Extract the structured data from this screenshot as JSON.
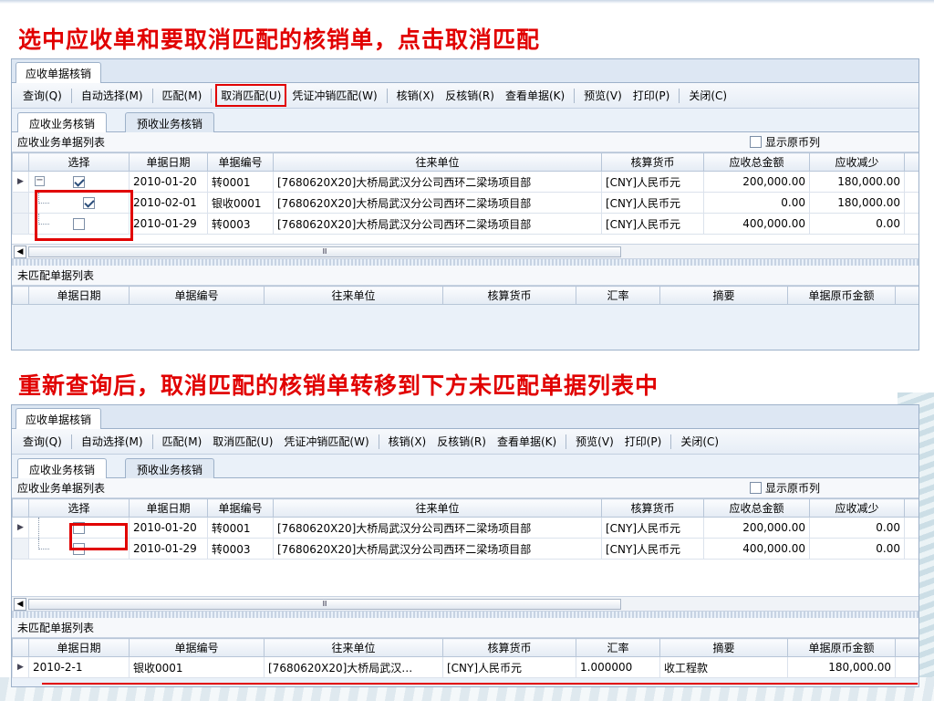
{
  "captions": {
    "top": "选中应收单和要取消匹配的核销单，点击取消匹配",
    "middle": "重新查询后，取消匹配的核销单转移到下方未匹配单据列表中"
  },
  "window": {
    "tab": "应收单据核销"
  },
  "toolbar": {
    "query": "查询(Q)",
    "auto_select": "自动选择(M)",
    "match": "匹配(M)",
    "cancel_match": "取消匹配(U)",
    "voucher_offset": "凭证冲销匹配(W)",
    "write_off": "核销(X)",
    "reverse_write_off": "反核销(R)",
    "view_document": "查看单据(K)",
    "preview": "预览(V)",
    "print": "打印(P)",
    "close": "关闭(C)"
  },
  "sub_tabs": {
    "receivable": "应收业务核销",
    "prepaid": "预收业务核销"
  },
  "upper_list": {
    "title": "应收业务单据列表",
    "show_original_currency": "显示原币列",
    "columns": [
      "选择",
      "单据日期",
      "单据编号",
      "往来单位",
      "核算货币",
      "应收总金额",
      "应收减少"
    ],
    "rows_before": [
      {
        "checked": true,
        "date": "2010-01-20",
        "number": "转0001",
        "partner": "[7680620X20]大桥局武汉分公司西环二梁场项目部",
        "currency": "[CNY]人民币元",
        "total": "200,000.00",
        "reduce": "180,000.00"
      },
      {
        "checked": true,
        "date": "2010-02-01",
        "number": "银收0001",
        "partner": "[7680620X20]大桥局武汉分公司西环二梁场项目部",
        "currency": "[CNY]人民币元",
        "total": "0.00",
        "reduce": "180,000.00"
      },
      {
        "checked": false,
        "date": "2010-01-29",
        "number": "转0003",
        "partner": "[7680620X20]大桥局武汉分公司西环二梁场项目部",
        "currency": "[CNY]人民币元",
        "total": "400,000.00",
        "reduce": "0.00"
      }
    ],
    "rows_after": [
      {
        "checked": false,
        "date": "2010-01-20",
        "number": "转0001",
        "partner": "[7680620X20]大桥局武汉分公司西环二梁场项目部",
        "currency": "[CNY]人民币元",
        "total": "200,000.00",
        "reduce": "0.00"
      },
      {
        "checked": false,
        "date": "2010-01-29",
        "number": "转0003",
        "partner": "[7680620X20]大桥局武汉分公司西环二梁场项目部",
        "currency": "[CNY]人民币元",
        "total": "400,000.00",
        "reduce": "0.00"
      }
    ],
    "scroll_thumb": "Ⅲ"
  },
  "lower_list": {
    "title": "未匹配单据列表",
    "columns": [
      "单据日期",
      "单据编号",
      "往来单位",
      "核算货币",
      "汇率",
      "摘要",
      "单据原币金额"
    ],
    "rows_after": [
      {
        "date": "2010-2-1",
        "number": "银收0001",
        "partner": "[7680620X20]大桥局武汉…",
        "currency": "[CNY]人民币元",
        "rate": "1.000000",
        "summary": "收工程款",
        "amount": "180,000.00"
      }
    ]
  },
  "colors": {
    "caption": "#e10000",
    "highlight": "#e10000",
    "window_bg": "#eaf1f9"
  }
}
